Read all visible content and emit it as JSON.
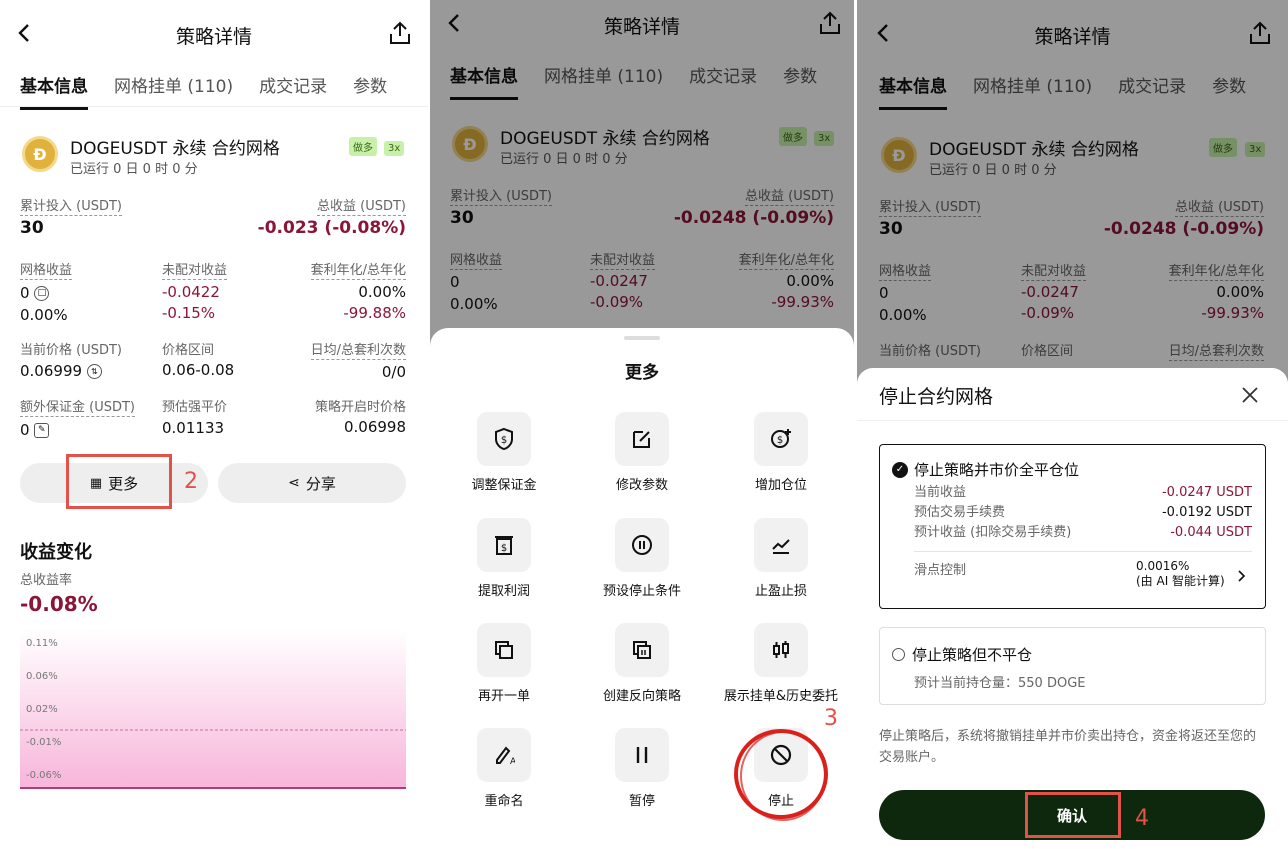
{
  "panel1": {
    "header": {
      "title": "策略详情"
    },
    "tabs": [
      "基本信息",
      "网格挂单 (110)",
      "成交记录",
      "参数"
    ],
    "strategy": {
      "name": "DOGEUSDT 永续 合约网格",
      "runtime": "已运行 0 日 0 时 0 分",
      "badge_side": "做多",
      "badge_lev": "3x"
    },
    "stats": {
      "invest_label": "累计投入 (USDT)",
      "invest_value": "30",
      "profit_label": "总收益 (USDT)",
      "profit_value": "-0.023 (-0.08%)",
      "grid_profit_label": "网格收益",
      "grid_profit_value": "0",
      "grid_profit_pct": "0.00%",
      "unmatched_label": "未配对收益",
      "unmatched_value": "-0.0422",
      "unmatched_pct": "-0.15%",
      "arb_label": "套利年化/总年化",
      "arb_value": "0.00%",
      "arb_total": "-99.88%",
      "price_label": "当前价格 (USDT)",
      "price_value": "0.06999",
      "range_label": "价格区间",
      "range_value": "0.06-0.08",
      "daily_label": "日均/总套利次数",
      "daily_value": "0/0",
      "margin_label": "额外保证金 (USDT)",
      "margin_value": "0",
      "liq_label": "预估强平价",
      "liq_value": "0.01133",
      "open_label": "策略开启时价格",
      "open_value": "0.06998"
    },
    "more_button": "更多",
    "share_button": "分享",
    "step2": "2",
    "chart_title": "收益变化",
    "chart_sub": "总收益率",
    "chart_value": "-0.08%",
    "chart_data": {
      "type": "area",
      "ticks": [
        "0.11%",
        "0.06%",
        "0.02%",
        "-0.01%",
        "-0.06%"
      ],
      "ylim": [
        -0.08,
        0.11
      ]
    }
  },
  "panel2": {
    "header": {
      "title": "策略详情"
    },
    "tabs": [
      "基本信息",
      "网格挂单 (110)",
      "成交记录",
      "参数"
    ],
    "strategy": {
      "name": "DOGEUSDT 永续 合约网格",
      "runtime": "已运行 0 日 0 时 0 分",
      "badge_side": "做多",
      "badge_lev": "3x"
    },
    "stats": {
      "invest_label": "累计投入 (USDT)",
      "invest_value": "30",
      "profit_label": "总收益 (USDT)",
      "profit_value": "-0.0248 (-0.09%)",
      "grid_profit_label": "网格收益",
      "grid_profit_value": "0",
      "grid_profit_pct": "0.00%",
      "unmatched_label": "未配对收益",
      "unmatched_value": "-0.0247",
      "unmatched_pct": "-0.09%",
      "arb_label": "套利年化/总年化",
      "arb_value": "0.00%",
      "arb_total": "-99.93%"
    },
    "sheet_title": "更多",
    "items": [
      "调整保证金",
      "修改参数",
      "增加仓位",
      "提取利润",
      "预设停止条件",
      "止盈止损",
      "再开一单",
      "创建反向策略",
      "展示挂单&历史委托",
      "重命名",
      "暂停",
      "停止"
    ],
    "step3": "3"
  },
  "panel3": {
    "header": {
      "title": "策略详情"
    },
    "tabs": [
      "基本信息",
      "网格挂单 (110)",
      "成交记录",
      "参数"
    ],
    "strategy": {
      "name": "DOGEUSDT 永续 合约网格",
      "runtime": "已运行 0 日 0 时 0 分",
      "badge_side": "做多",
      "badge_lev": "3x"
    },
    "stats": {
      "invest_label": "累计投入 (USDT)",
      "invest_value": "30",
      "profit_label": "总收益 (USDT)",
      "profit_value": "-0.0248 (-0.09%)",
      "grid_profit_label": "网格收益",
      "grid_profit_value": "0",
      "grid_profit_pct": "0.00%",
      "unmatched_label": "未配对收益",
      "unmatched_value": "-0.0247",
      "unmatched_pct": "-0.09%",
      "arb_label": "套利年化/总年化",
      "arb_value": "0.00%",
      "arb_total": "-99.93%",
      "price_label": "当前价格 (USDT)",
      "range_label": "价格区间",
      "daily_label": "日均/总套利次数"
    },
    "dialog_title": "停止合约网格",
    "option1": {
      "label": "停止策略并市价全平仓位",
      "rows": [
        {
          "k": "当前收益",
          "v": "-0.0247 USDT",
          "neg": true
        },
        {
          "k": "预估交易手续费",
          "v": "-0.0192 USDT",
          "neg": false
        },
        {
          "k": "预计收益 (扣除交易手续费)",
          "v": "-0.044 USDT",
          "neg": true
        }
      ],
      "slippage_label": "滑点控制",
      "slippage_value": "0.0016%",
      "slippage_note": "(由 AI 智能计算)"
    },
    "option2": {
      "label": "停止策略但不平仓",
      "note": "预计当前持仓量：550 DOGE"
    },
    "disclaimer": "停止策略后，系统将撤销挂单并市价卖出持仓，资金将返还至您的交易账户。",
    "confirm": "确认",
    "step4": "4"
  }
}
